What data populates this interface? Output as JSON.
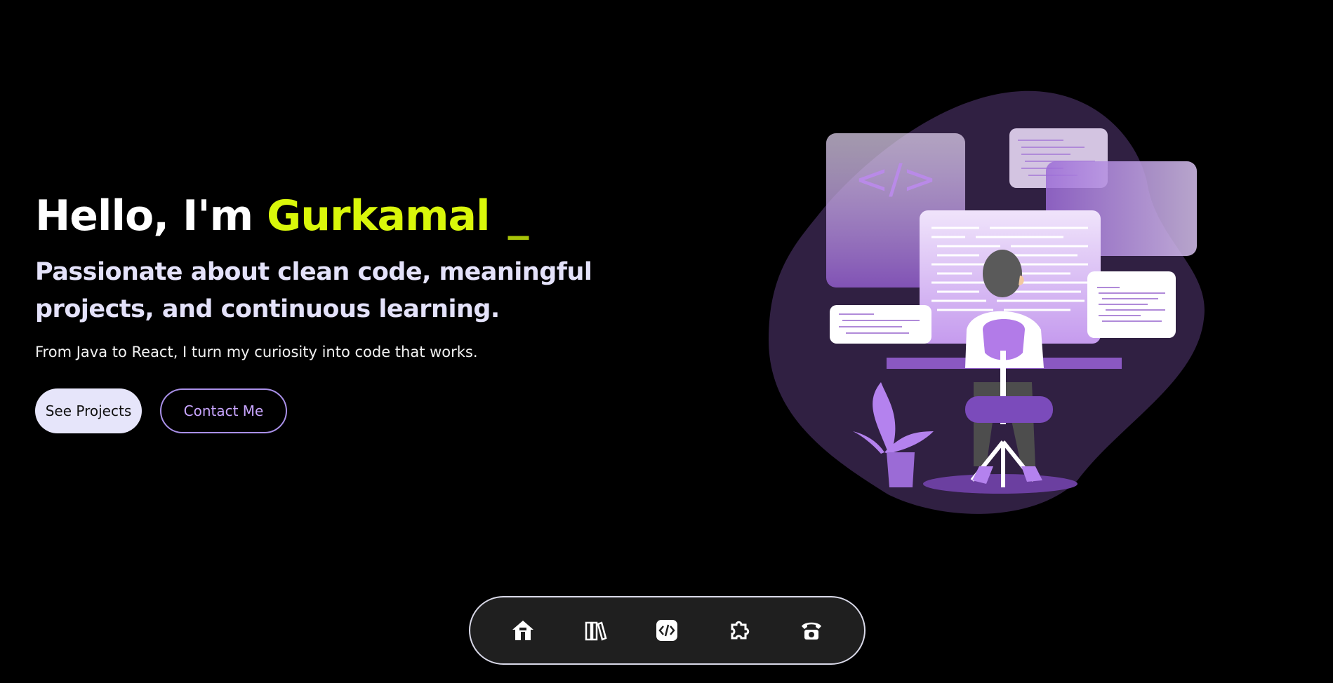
{
  "hero": {
    "greeting_prefix": "Hello, I'm",
    "name": "Gurkamal",
    "cursor": "_",
    "tagline": "Passionate about clean code, meaningful projects, and continuous learning.",
    "subline": "From Java to React, I turn my curiosity into code that works."
  },
  "buttons": {
    "primary_label": "See Projects",
    "secondary_label": "Contact Me"
  },
  "illustration": {
    "code_symbol": "</>"
  },
  "dock": {
    "items": [
      {
        "icon": "home-icon"
      },
      {
        "icon": "books-icon"
      },
      {
        "icon": "code-icon"
      },
      {
        "icon": "puzzle-icon"
      },
      {
        "icon": "telephone-icon"
      }
    ]
  },
  "colors": {
    "background": "#000000",
    "accent_name": "#d9f70a",
    "tagline": "#e4e2fa",
    "primary_button_bg": "#e6e5fa",
    "secondary_button_text": "#c9a6ff",
    "purple": "#9b6bd6"
  }
}
